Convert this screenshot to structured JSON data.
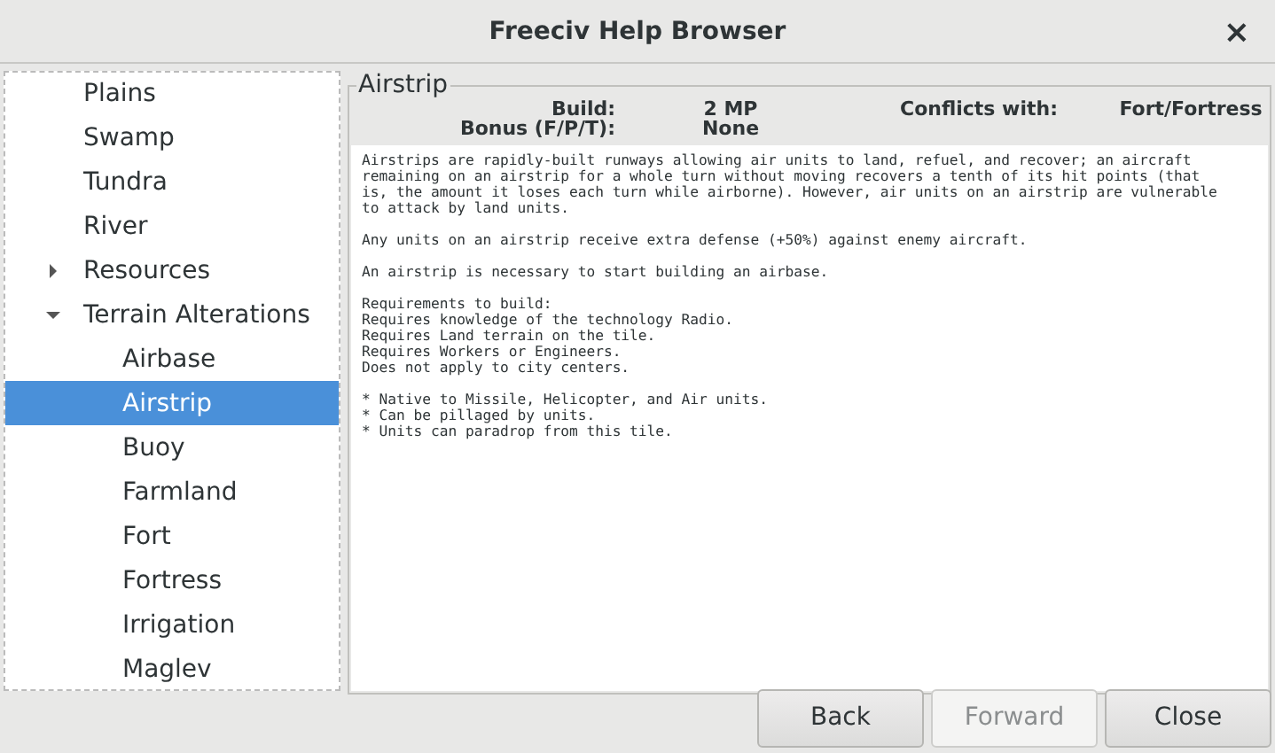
{
  "window": {
    "title": "Freeciv Help Browser",
    "close": "×"
  },
  "sidebar": {
    "items": [
      {
        "label": "Plains",
        "selected": false
      },
      {
        "label": "Swamp",
        "selected": false
      },
      {
        "label": "Tundra",
        "selected": false
      },
      {
        "label": "River",
        "selected": false
      },
      {
        "label": "Resources",
        "selected": false,
        "expanded": false
      },
      {
        "label": "Terrain Alterations",
        "selected": false,
        "expanded": true,
        "children": [
          {
            "label": "Airbase",
            "selected": false
          },
          {
            "label": "Airstrip",
            "selected": true
          },
          {
            "label": "Buoy",
            "selected": false
          },
          {
            "label": "Farmland",
            "selected": false
          },
          {
            "label": "Fort",
            "selected": false
          },
          {
            "label": "Fortress",
            "selected": false
          },
          {
            "label": "Irrigation",
            "selected": false
          },
          {
            "label": "Maglev",
            "selected": false
          }
        ]
      }
    ]
  },
  "content": {
    "title": "Airstrip",
    "info": [
      {
        "label": "Build:",
        "value": "2 MP",
        "label2": "Conflicts with:",
        "value2": "Fort/Fortress"
      },
      {
        "label": "Bonus (F/P/T):",
        "value": "None"
      }
    ],
    "paragraphs": [
      "Airstrips are rapidly-built runways allowing air units to land, refuel, and recover; an aircraft\nremaining on an airstrip for a whole turn without moving recovers a tenth of its hit points (that\nis, the amount it loses each turn while airborne). However, air units on an airstrip are vulnerable\nto attack by land units.",
      "Any units on an airstrip receive extra defense (+50%) against enemy aircraft.",
      "An airstrip is necessary to start building an airbase.",
      "Requirements to build:\nRequires knowledge of the technology Radio.\nRequires Land terrain on the tile.\nRequires Workers or Engineers.\nDoes not apply to city centers.",
      "* Native to Missile, Helicopter, and Air units.\n* Can be pillaged by units.\n* Units can paradrop from this tile."
    ]
  },
  "buttons": [
    {
      "label": "Back",
      "disabled": false
    },
    {
      "label": "Forward",
      "disabled": true
    },
    {
      "label": "Close",
      "disabled": false
    }
  ]
}
